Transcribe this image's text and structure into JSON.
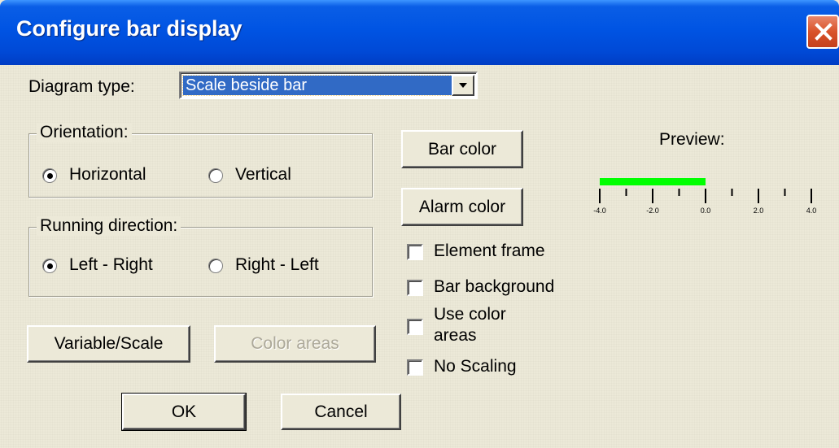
{
  "window": {
    "title": "Configure bar display"
  },
  "diagram_type": {
    "label": "Diagram type:",
    "value": "Scale beside bar"
  },
  "orientation": {
    "label": "Orientation:",
    "options": [
      {
        "label": "Horizontal",
        "checked": true
      },
      {
        "label": "Vertical",
        "checked": false
      }
    ]
  },
  "running_direction": {
    "label": "Running direction:",
    "options": [
      {
        "label": "Left - Right",
        "checked": true
      },
      {
        "label": "Right - Left",
        "checked": false
      }
    ]
  },
  "buttons": {
    "bar_color": "Bar color",
    "alarm_color": "Alarm color",
    "variable_scale": "Variable/Scale",
    "color_areas": "Color areas",
    "ok": "OK",
    "cancel": "Cancel"
  },
  "checkboxes": [
    {
      "label": "Element frame",
      "checked": false
    },
    {
      "label": "Bar background",
      "checked": false
    },
    {
      "label_line1": "Use color",
      "label_line2": "areas",
      "checked": false
    },
    {
      "label": "No Scaling",
      "checked": false
    }
  ],
  "preview": {
    "label": "Preview:",
    "bar_color": "#00ff00",
    "bar_from": -4.0,
    "bar_to": 0.0,
    "scale_min": -4.0,
    "scale_max": 4.0,
    "tick_labels": [
      "-4.0",
      "-2.0",
      "0.0",
      "2.0",
      "4.0"
    ]
  }
}
